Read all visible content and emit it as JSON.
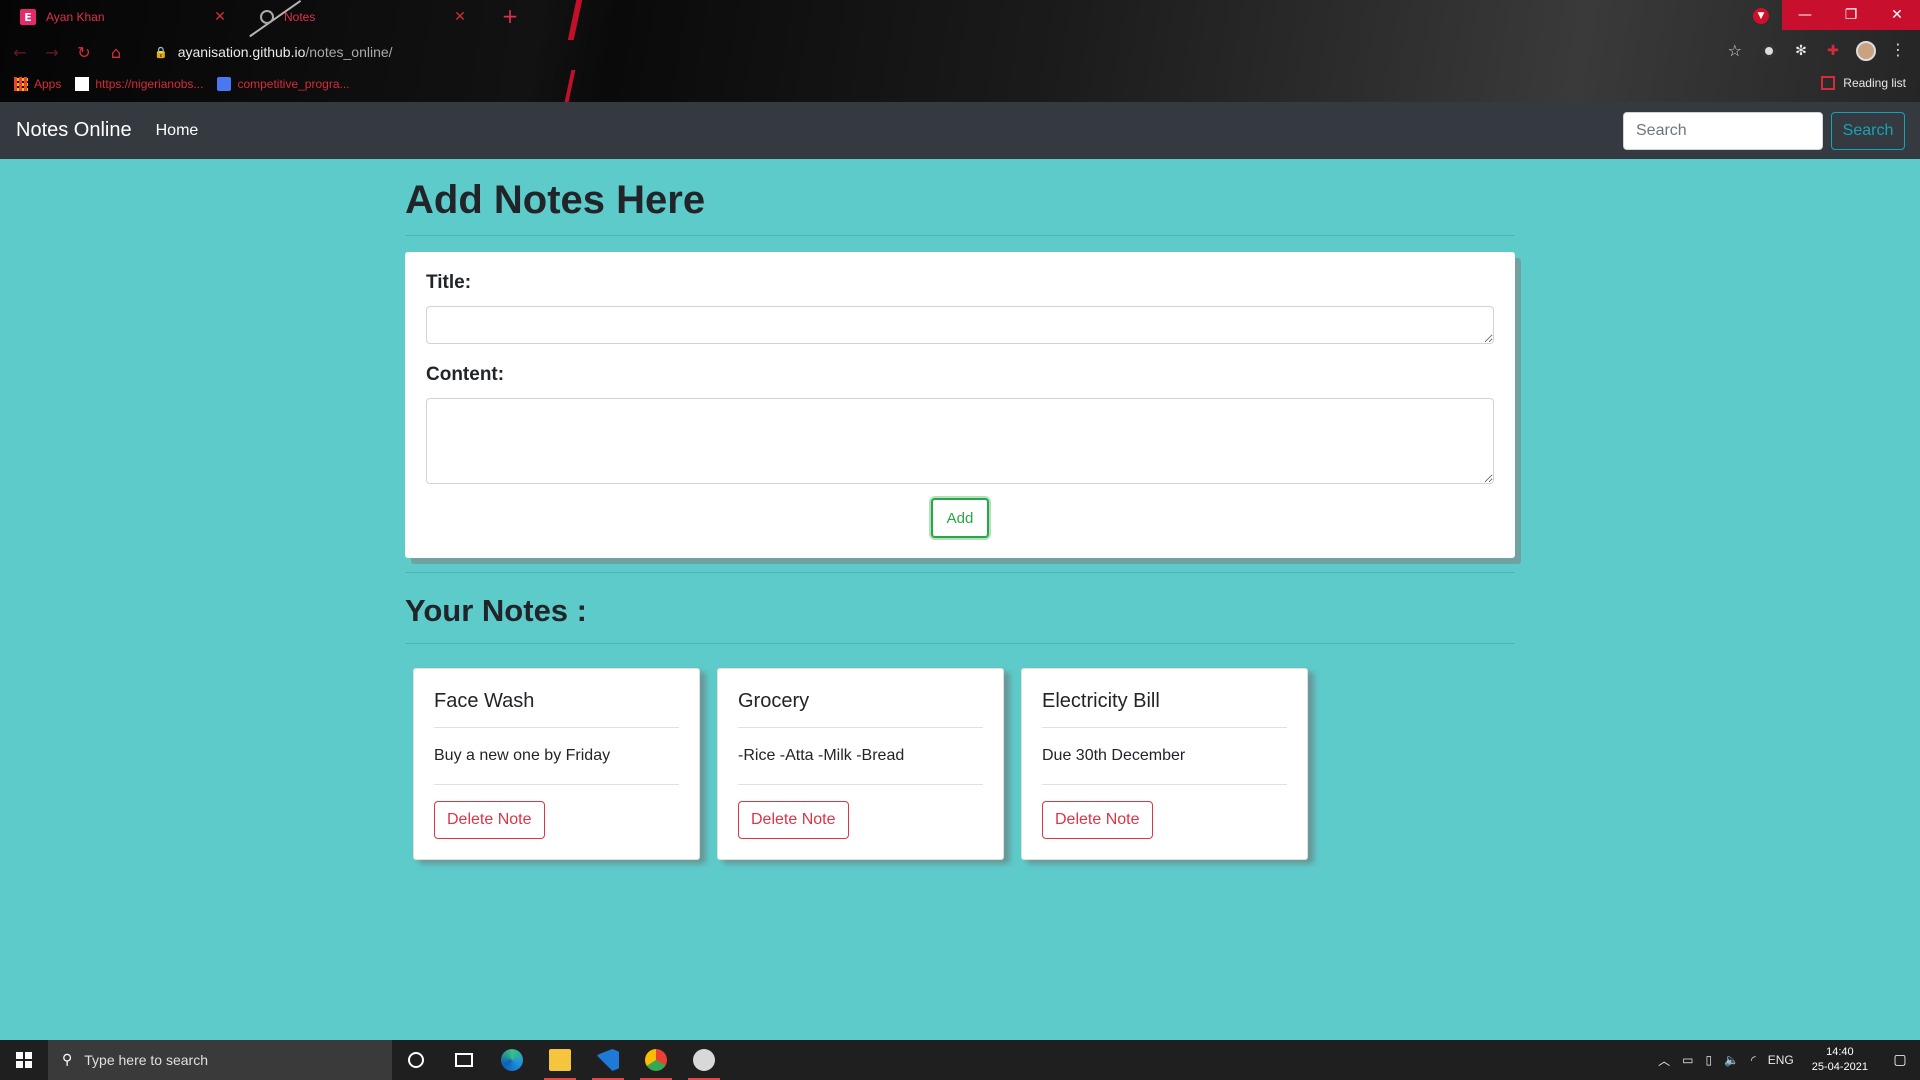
{
  "browser": {
    "tabs": [
      {
        "title": "Ayan Khan",
        "favicon": "E"
      },
      {
        "title": "Notes"
      }
    ],
    "url_host": "ayanisation.github.io",
    "url_path": "/notes_online/",
    "bookmarks": [
      {
        "label": "Apps"
      },
      {
        "label": "https://nigerianobs..."
      },
      {
        "label": "competitive_progra..."
      }
    ],
    "reading_list": "Reading list",
    "accent": "#d52b3c"
  },
  "navbar": {
    "brand": "Notes Online",
    "home": "Home",
    "search_placeholder": "Search",
    "search_button": "Search"
  },
  "form": {
    "heading": "Add Notes Here",
    "title_label": "Title:",
    "content_label": "Content:",
    "add_button": "Add"
  },
  "notes_section": {
    "heading": "Your Notes :",
    "notes": [
      {
        "title": "Face Wash",
        "text": "Buy a new one by Friday",
        "delete_label": "Delete Note"
      },
      {
        "title": "Grocery",
        "text": "-Rice -Atta -Milk -Bread",
        "delete_label": "Delete Note"
      },
      {
        "title": "Electricity Bill",
        "text": "Due 30th December",
        "delete_label": "Delete Note"
      }
    ]
  },
  "taskbar": {
    "search_placeholder": "Type here to search",
    "language": "ENG",
    "time": "14:40",
    "date": "25-04-2021"
  },
  "colors": {
    "page_bg": "#5ecbcb",
    "navbar_bg": "#343a40",
    "success": "#28a745",
    "danger": "#dc3545",
    "info": "#17a2b8"
  }
}
